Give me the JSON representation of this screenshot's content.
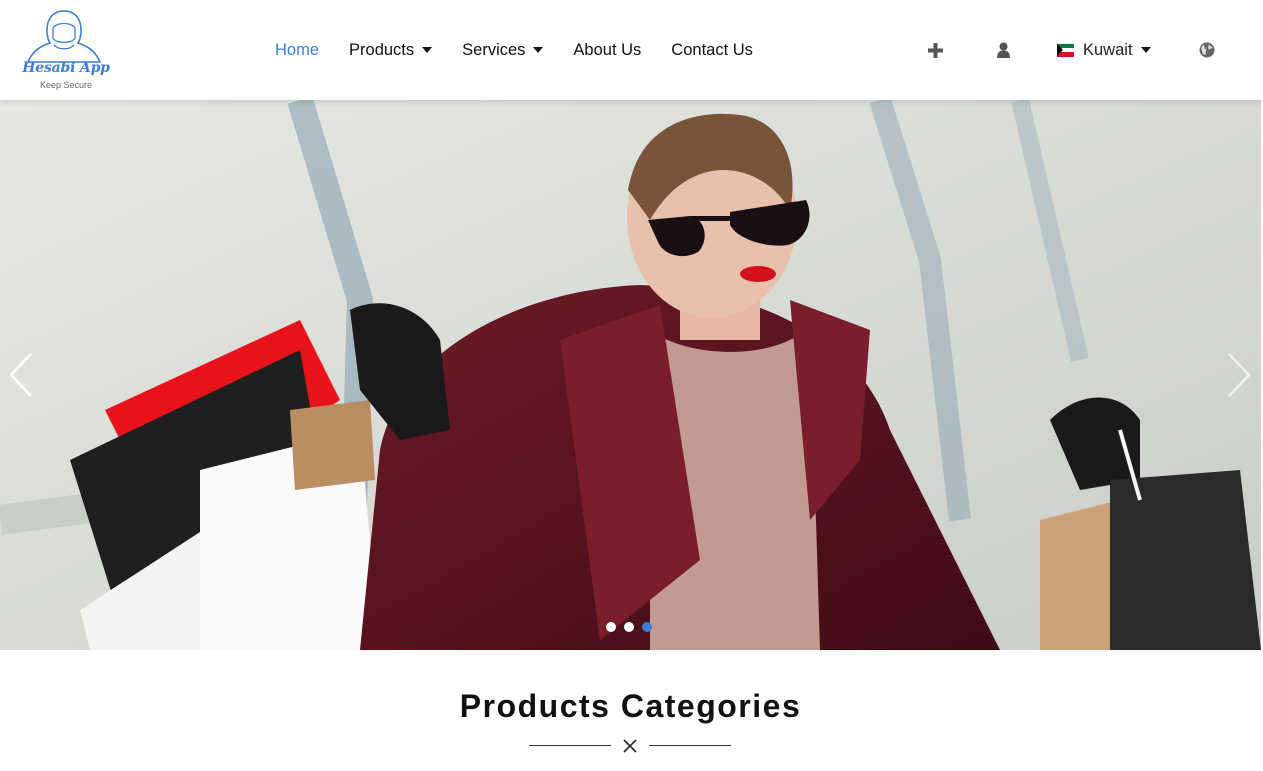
{
  "brand": {
    "name": "Hesabi App",
    "tagline": "Keep Secure",
    "accent_color": "#3b7dd8"
  },
  "nav": {
    "links": [
      {
        "label": "Home",
        "active": true,
        "dropdown": false
      },
      {
        "label": "Products",
        "active": false,
        "dropdown": true
      },
      {
        "label": "Services",
        "active": false,
        "dropdown": true
      },
      {
        "label": "About Us",
        "active": false,
        "dropdown": false
      },
      {
        "label": "Contact Us",
        "active": false,
        "dropdown": false
      }
    ],
    "icons": {
      "add": "plus-icon",
      "account": "user-icon",
      "language": "globe-icon"
    },
    "country": {
      "label": "Kuwait",
      "flag": "kuwait-flag-icon"
    }
  },
  "carousel": {
    "slide_image": "woman-shopping-bags-photo",
    "prev": "chevron-left-icon",
    "next": "chevron-right-icon",
    "slide_count": 3,
    "active_index": 2
  },
  "section": {
    "title": "Products Categories",
    "divider_icon": "close-icon"
  }
}
